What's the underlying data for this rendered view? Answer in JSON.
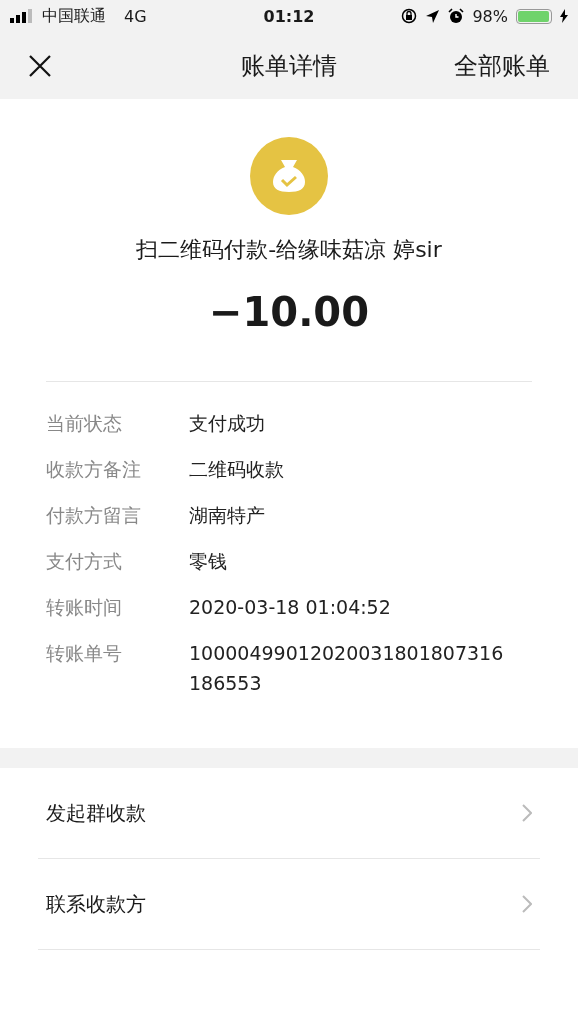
{
  "status_bar": {
    "carrier": "中国联通",
    "network": "4G",
    "time": "01:12",
    "battery": "98%"
  },
  "nav": {
    "title": "账单详情",
    "action": "全部账单"
  },
  "summary": {
    "title": "扫二维码付款-给缘味菇凉 婷sir",
    "amount": "−10.00"
  },
  "details": [
    {
      "label": "当前状态",
      "value": "支付成功"
    },
    {
      "label": "收款方备注",
      "value": "二维码收款"
    },
    {
      "label": "付款方留言",
      "value": "湖南特产"
    },
    {
      "label": "支付方式",
      "value": "零钱"
    },
    {
      "label": "转账时间",
      "value": "2020-03-18 01:04:52"
    },
    {
      "label": "转账单号",
      "value": "10000499012020031801807316186553"
    }
  ],
  "actions": [
    {
      "label": "发起群收款"
    },
    {
      "label": "联系收款方"
    }
  ]
}
